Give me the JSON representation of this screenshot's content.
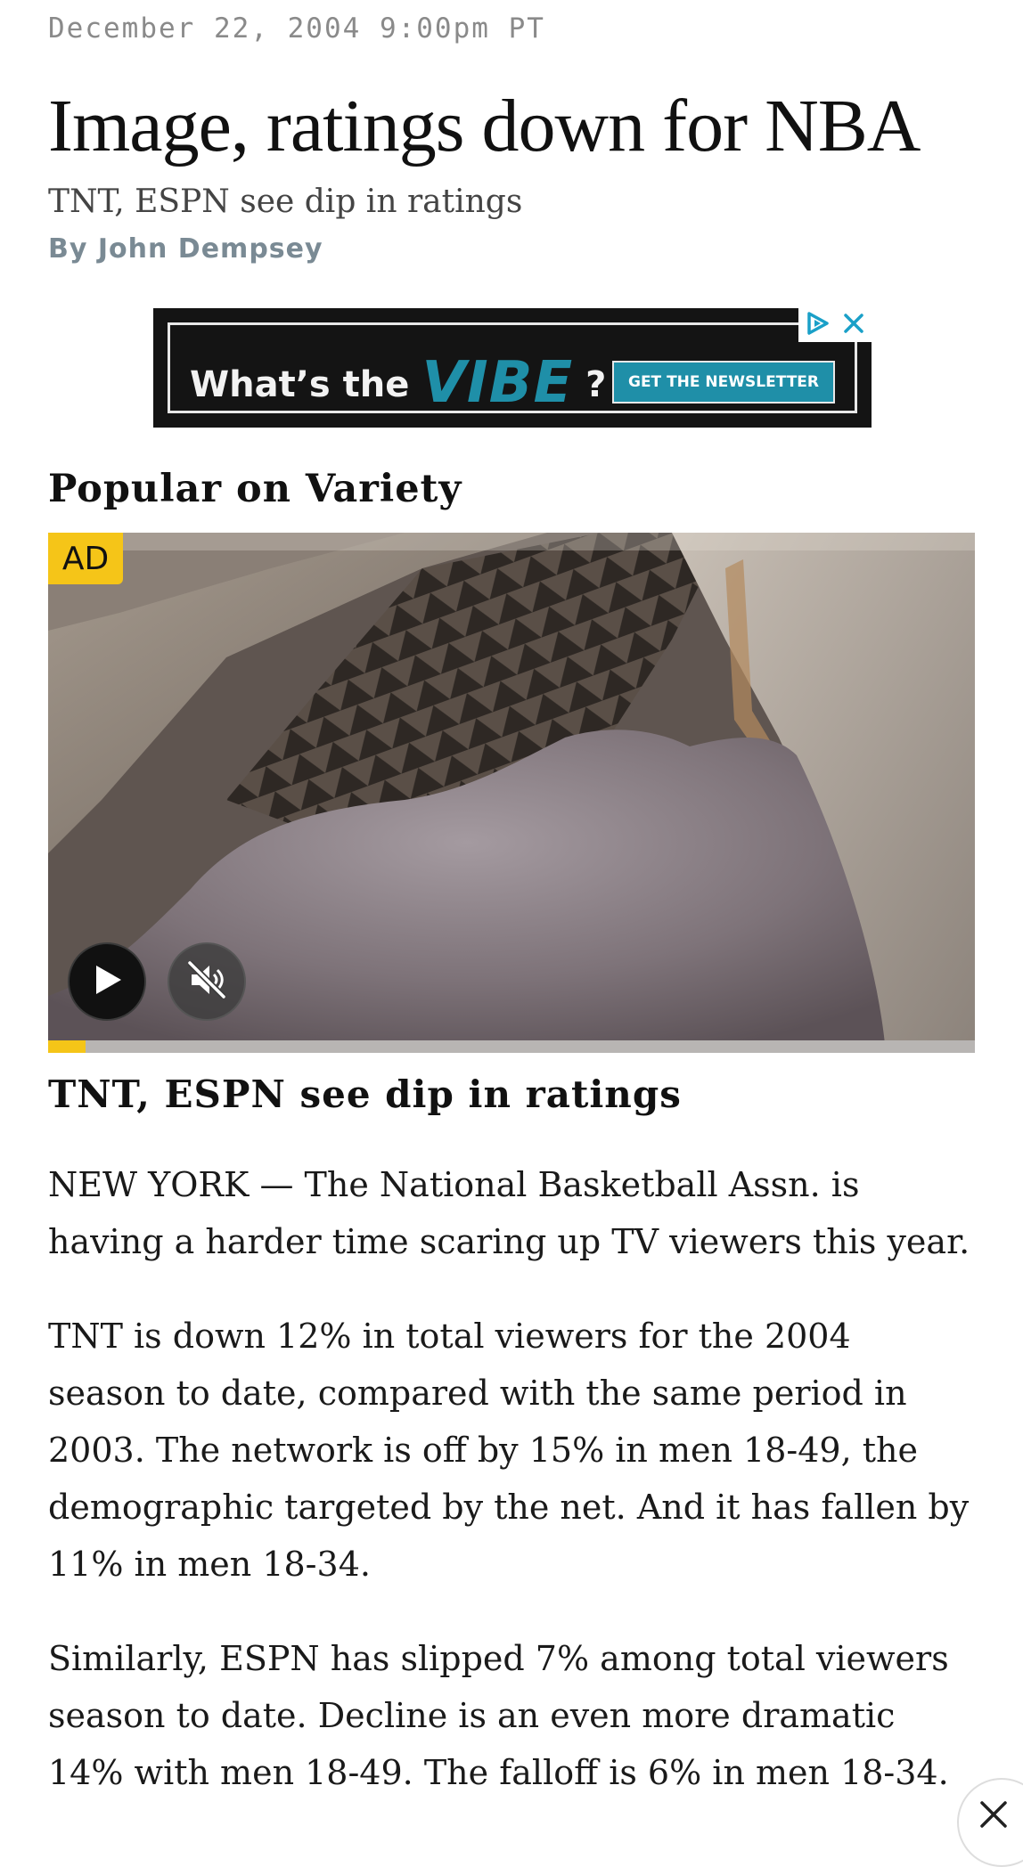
{
  "article": {
    "dateline": "December 22, 2004 9:00pm PT",
    "headline": "Image, ratings down for NBA",
    "dek": "TNT, ESPN see dip in ratings",
    "byline_prefix": "By ",
    "author": "John Dempsey",
    "paragraphs": [
      "NEW YORK — The National Basketball Assn. is having a harder time scaring up TV viewers this year.",
      "TNT is down 12% in total viewers for the 2004 season to date, compared with the same period in 2003. The network is off by 15% in men 18-49, the demographic targeted by the net. And it has fallen by 11% in men 18-34.",
      "Similarly, ESPN has slipped 7% among total viewers season to date. Decline is an even more dramatic 14% with men 18-49. The falloff is 6% in men 18-34."
    ]
  },
  "ad_banner": {
    "text_prefix": "What’s the",
    "brand": "VIBE",
    "text_suffix": "?",
    "cta": "GET THE NEWSLETTER",
    "icons": [
      "adchoices-icon",
      "close-icon"
    ]
  },
  "popular": {
    "section_title": "Popular on Variety",
    "ad_badge": "AD",
    "video_title": "TNT, ESPN see dip in ratings",
    "progress": 0.04,
    "icons": [
      "play-icon",
      "mute-icon"
    ]
  },
  "colors": {
    "accent_yellow": "#f5c518",
    "vibe_teal": "#1f8fa8",
    "byline_gray": "#7a8a94"
  },
  "floating": {
    "icon": "close-icon"
  }
}
